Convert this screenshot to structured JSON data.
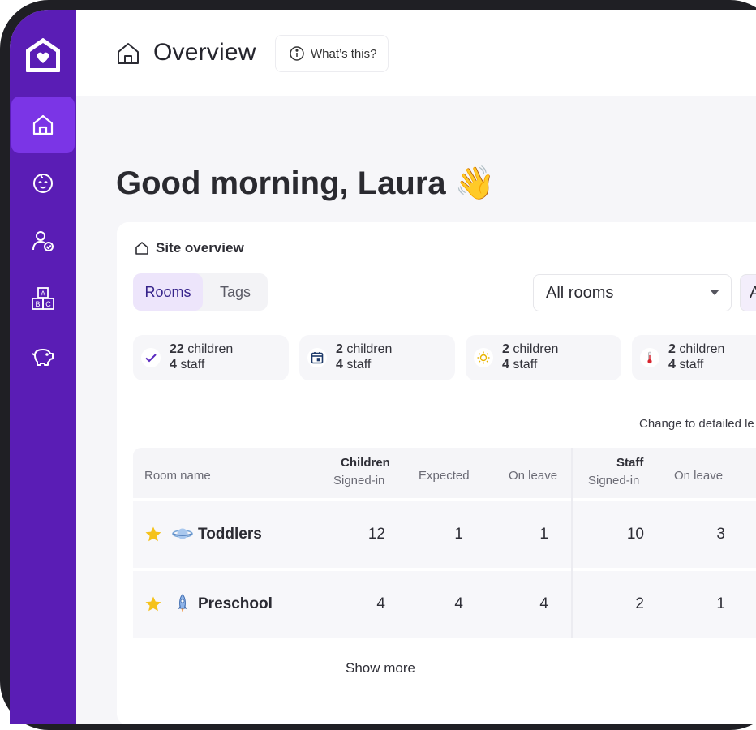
{
  "header": {
    "title": "Overview",
    "whats_this": "What’s this?"
  },
  "greeting": "Good morning, Laura 👋",
  "sidebar": {
    "items": [
      {
        "icon": "home-icon",
        "active": true
      },
      {
        "icon": "baby-face-icon",
        "active": false
      },
      {
        "icon": "staff-check-icon",
        "active": false
      },
      {
        "icon": "abc-blocks-icon",
        "active": false
      },
      {
        "icon": "piggy-bank-icon",
        "active": false
      }
    ]
  },
  "site_overview": {
    "title": "Site overview",
    "tabs": [
      "Rooms",
      "Tags"
    ],
    "room_select": "All rooms",
    "second_select": "A",
    "stats": [
      {
        "icon": "check-icon",
        "children_count": "22",
        "children_label": "children",
        "staff_count": "4",
        "staff_label": "staff"
      },
      {
        "icon": "calendar-icon",
        "children_count": "2",
        "children_label": "children",
        "staff_count": "4",
        "staff_label": "staff"
      },
      {
        "icon": "sun-icon",
        "children_count": "2",
        "children_label": "children",
        "staff_count": "4",
        "staff_label": "staff"
      },
      {
        "icon": "thermometer-icon",
        "children_count": "2",
        "children_label": "children",
        "staff_count": "4",
        "staff_label": "staff"
      }
    ],
    "change_view": "Change to detailed le",
    "table": {
      "headers": {
        "room_name": "Room name",
        "children_group": "Children",
        "children_signed_in": "Signed-in",
        "expected": "Expected",
        "on_leave": "On leave",
        "staff_group": "Staff",
        "staff_signed_in": "Signed-in",
        "staff_on_leave": "On leave"
      },
      "rows": [
        {
          "emoji": "planet-icon",
          "name": "Toddlers",
          "children_signed_in": "12",
          "expected": "1",
          "on_leave": "1",
          "staff_signed_in": "10",
          "staff_on_leave": "3"
        },
        {
          "emoji": "rocket-icon",
          "name": "Preschool",
          "children_signed_in": "4",
          "expected": "4",
          "on_leave": "4",
          "staff_signed_in": "2",
          "staff_on_leave": "1"
        }
      ]
    },
    "show_more": "Show more"
  },
  "colors": {
    "sidebar": "#5a1db5",
    "sidebar_active": "#7b35e6",
    "accent_tab": "#ede5fb",
    "star": "#f5c21b"
  }
}
